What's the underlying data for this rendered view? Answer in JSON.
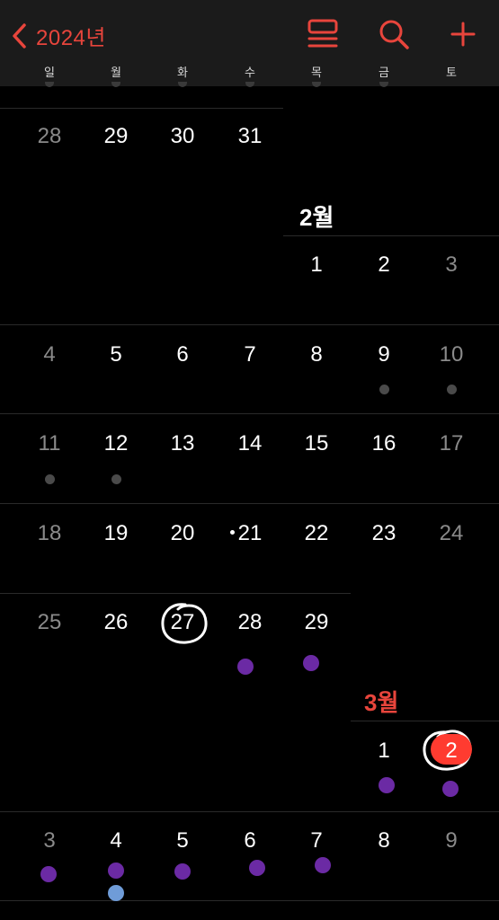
{
  "header": {
    "back_label": "2024년",
    "weekdays": [
      "일",
      "월",
      "화",
      "수",
      "목",
      "금",
      "토"
    ],
    "accent_color": "#e8453c"
  },
  "months": {
    "feb": "2월",
    "mar": "3월"
  },
  "days": {
    "r0": [
      "28",
      "29",
      "30",
      "31"
    ],
    "r1": [
      "1",
      "2",
      "3"
    ],
    "r2": [
      "4",
      "5",
      "6",
      "7",
      "8",
      "9",
      "10"
    ],
    "r3": [
      "11",
      "12",
      "13",
      "14",
      "15",
      "16",
      "17"
    ],
    "r4": [
      "18",
      "19",
      "20",
      "21",
      "22",
      "23",
      "24"
    ],
    "r5": [
      "25",
      "26",
      "27",
      "28",
      "29"
    ],
    "r6": [
      "1",
      "2"
    ],
    "r7": [
      "3",
      "4",
      "5",
      "6",
      "7",
      "8",
      "9"
    ]
  },
  "colors": {
    "today_circle": "#ff3b30",
    "event_purple": "#6b2aa4",
    "event_blue": "#6f9cd8",
    "event_gray": "#4a4a4a"
  }
}
